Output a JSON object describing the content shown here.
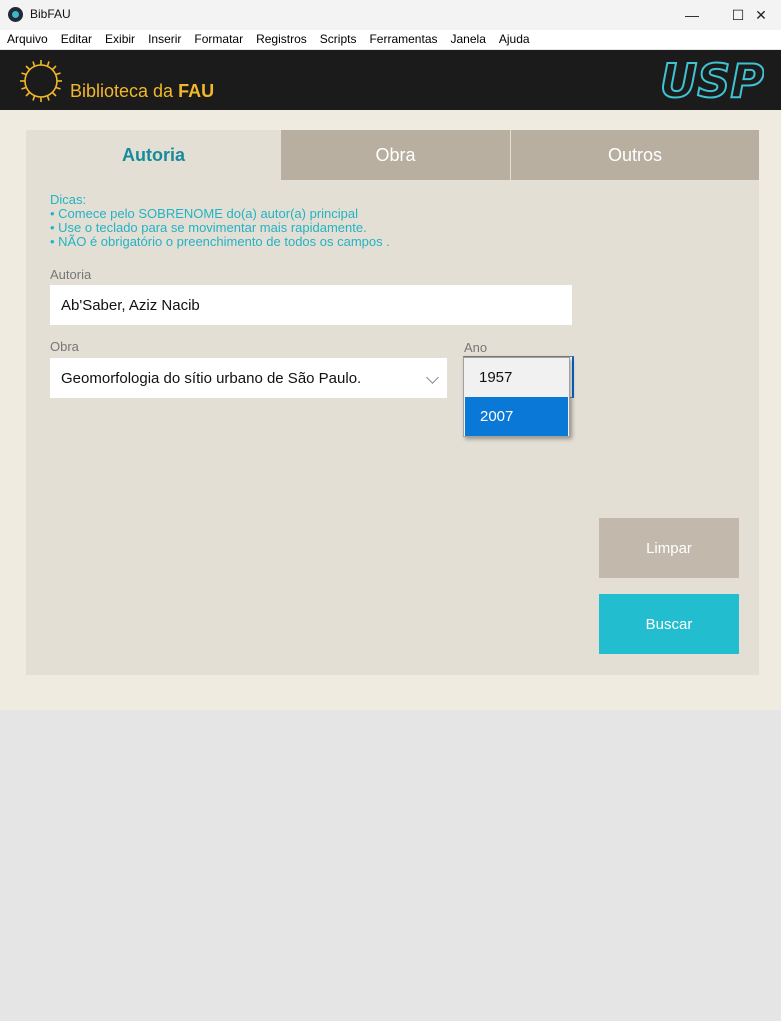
{
  "window": {
    "title": "BibFAU",
    "minimize_glyph": "—",
    "maximize_glyph": "☐",
    "close_glyph": "✕"
  },
  "menu": [
    "Arquivo",
    "Editar",
    "Exibir",
    "Inserir",
    "Formatar",
    "Registros",
    "Scripts",
    "Ferramentas",
    "Janela",
    "Ajuda"
  ],
  "header": {
    "title_prefix": "Biblioteca da ",
    "title_bold": "FAU",
    "logo_text": "USP",
    "logo_icon": "sun-icon"
  },
  "tabs": [
    {
      "label": "Autoria",
      "active": true
    },
    {
      "label": "Obra",
      "active": false
    },
    {
      "label": "Outros",
      "active": false
    }
  ],
  "hints": {
    "title": "Dicas:",
    "lines": [
      "• Comece pelo SOBRENOME do(a) autor(a) principal",
      "• Use o teclado para se movimentar mais rapidamente.",
      "• NÃO é obrigatório o preenchimento de todos os campos ."
    ]
  },
  "form": {
    "autoria_label": "Autoria",
    "autoria_value": "Ab'Saber, Aziz Nacib",
    "obra_label": "Obra",
    "obra_value": "Geomorfologia do sítio urbano de São Paulo.",
    "ano_label": "Ano",
    "ano_options": [
      {
        "label": "1957",
        "selected": false
      },
      {
        "label": "2007",
        "selected": true
      }
    ]
  },
  "buttons": {
    "clear": "Limpar",
    "search": "Buscar"
  },
  "colors": {
    "accent_teal": "#168b9b",
    "hint_cyan": "#22b3c4",
    "header_gold": "#f2b829",
    "search_button": "#22bed0",
    "selection_blue": "#0a78d7"
  }
}
